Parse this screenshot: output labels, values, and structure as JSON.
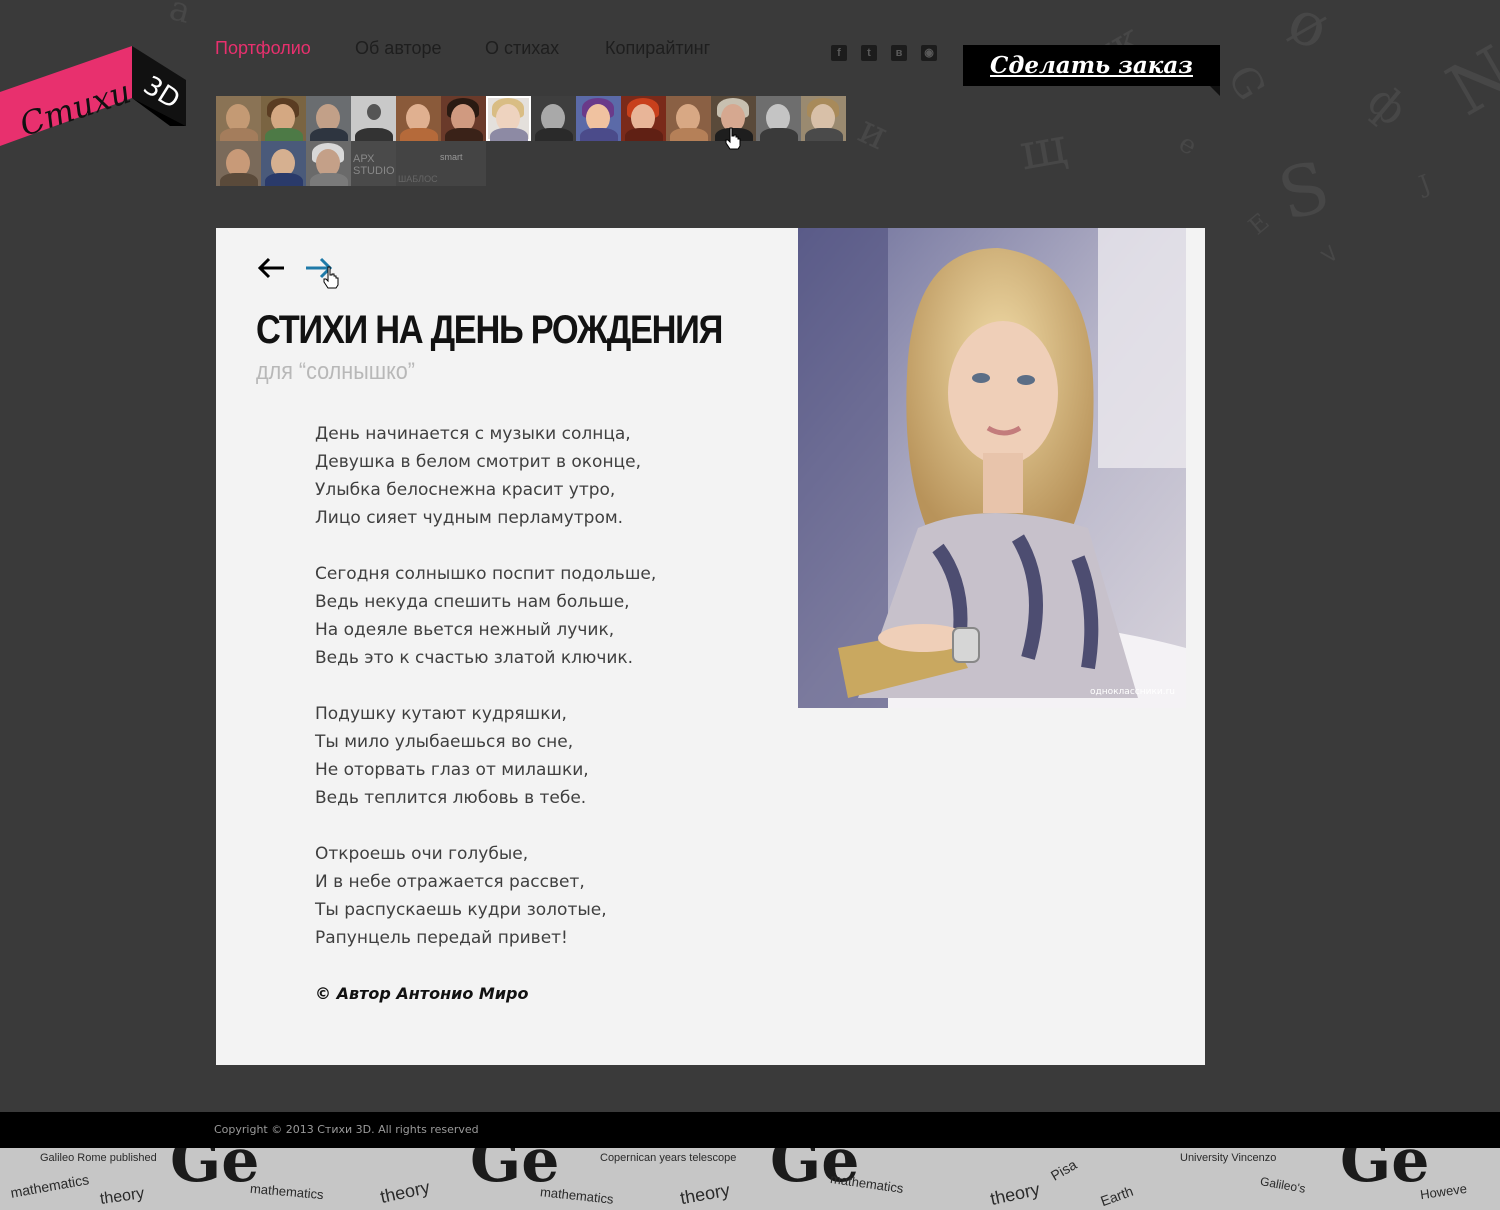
{
  "colors": {
    "accent": "#e8306e",
    "link_hover": "#1f7aa8",
    "background": "#3a3a3a",
    "panel": "#f3f3f3"
  },
  "logo": {
    "text": "Стихи",
    "badge": "3D"
  },
  "nav": {
    "items": [
      {
        "label": "Портфолио",
        "active": true
      },
      {
        "label": "Об авторе"
      },
      {
        "label": "О стихах"
      },
      {
        "label": "Копирайтинг"
      }
    ]
  },
  "social": [
    {
      "icon": "facebook-icon",
      "glyph": "f"
    },
    {
      "icon": "twitter-icon",
      "glyph": "t"
    },
    {
      "icon": "vkontakte-icon",
      "glyph": "в"
    },
    {
      "icon": "rss-icon",
      "glyph": "◉"
    }
  ],
  "order_button": {
    "label": "Сделать заказ"
  },
  "thumbnails": {
    "studio_label": "АРХ STUDIO",
    "partner_label": "smart",
    "partner_sub": "ШАБЛОС"
  },
  "article": {
    "title": "Стихи на день рождения",
    "subtitle": "для “солнышко”",
    "stanzas": [
      [
        "День начинается с музыки солнца,",
        "Девушка в белом смотрит в оконце,",
        "Улыбка белоснежна красит утро,",
        "Лицо сияет чудным перламутром."
      ],
      [
        "Сегодня солнышко поспит подольше,",
        "Ведь некуда спешить нам больше,",
        "На одеяле вьется нежный лучик,",
        "Ведь это к счастью златой ключик."
      ],
      [
        "Подушку кутают кудряшки,",
        "Ты мило улыбаешься во сне,",
        "Не оторвать глаз от милашки,",
        "Ведь теплится любовь в тебе."
      ],
      [
        "Откроешь очи голубые,",
        "И в небе отражается рассвет,",
        "Ты распускаешь кудри золотые,",
        "Рапунцель передай привет!"
      ]
    ],
    "author": "© Автор Антонио Миро",
    "photo_watermark": "одноклассники.ru"
  },
  "footer": {
    "copyright": "Copyright © 2013 Стихи 3D. All rights reserved"
  }
}
